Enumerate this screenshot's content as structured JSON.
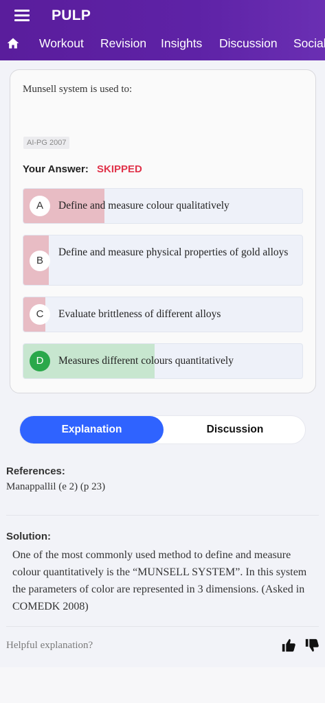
{
  "app": {
    "title": "PULP"
  },
  "nav": {
    "items": [
      "Workout",
      "Revision",
      "Insights",
      "Discussion",
      "Social"
    ]
  },
  "question": {
    "text": "Munsell system is used to:",
    "tag": "AI-PG 2007",
    "your_answer_label": "Your Answer:",
    "your_answer_value": "SKIPPED"
  },
  "options": [
    {
      "letter": "A",
      "text": "Define and measure colour qualitatively",
      "response_fraction": 0.29,
      "correct": false
    },
    {
      "letter": "B",
      "text": "Define and measure physical properties of gold alloys",
      "response_fraction": 0.09,
      "correct": false
    },
    {
      "letter": "C",
      "text": "Evaluate brittleness of different alloys",
      "response_fraction": 0.08,
      "correct": false
    },
    {
      "letter": "D",
      "text": "Measures different colours quantitatively",
      "response_fraction": 0.47,
      "correct": true
    }
  ],
  "tabs": {
    "explanation": "Explanation",
    "discussion": "Discussion",
    "active": "explanation"
  },
  "explanation": {
    "references_label": "References:",
    "references_text": "Manappallil (e 2) (p 23)",
    "solution_label": "Solution:",
    "solution_text": "One of the most commonly used method to define and measure colour quantitatively is the “MUNSELL SYSTEM”. In this system the parameters of color are represented in 3 dimensions. (Asked in COMEDK 2008)",
    "helpful_label": "Helpful explanation?"
  },
  "colors": {
    "header": "#5a1d9c",
    "accent": "#2f63ff",
    "wrong_fill": "#e8bcc4",
    "correct_fill": "#c7e6cf",
    "correct_badge": "#2aa84a",
    "skipped": "#e0334a"
  },
  "icons": [
    "hamburger-menu-icon",
    "home-icon",
    "thumbs-up-icon",
    "thumbs-down-icon"
  ]
}
